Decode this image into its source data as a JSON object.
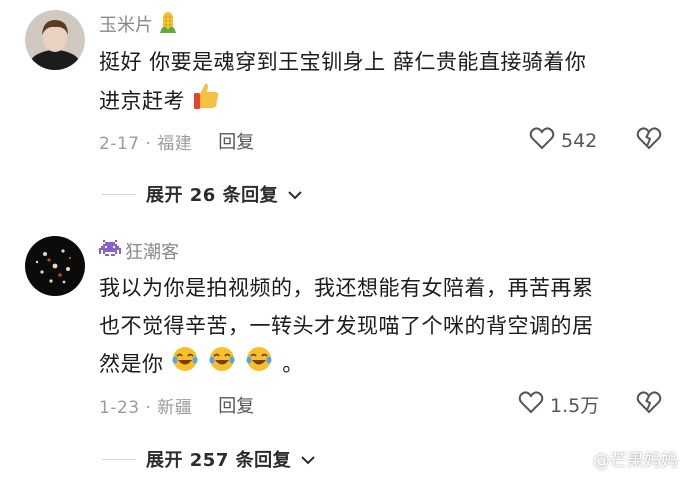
{
  "colors": {
    "username": "#8a8a8a",
    "text": "#1c1c1c",
    "meta": "#9b9b9b",
    "divider": "#d6d6d6"
  },
  "comments": [
    {
      "username": "玉米片",
      "username_badge": "corn-icon",
      "text_line1": "挺好  你要是魂穿到王宝钏身上  薛仁贵能直接骑着你",
      "text_line2": "进京赶考",
      "text_emoji": "thumbs-up-icon",
      "date_location": "2-17 · 福建",
      "reply_label": "回复",
      "likes": "542",
      "expand_label": "展开 26 条回复"
    },
    {
      "username": "狂潮客",
      "username_badge": "space-invader-icon",
      "text_line1": "我以为你是拍视频的，我还想能有女陪着，再苦再累",
      "text_line2": "也不觉得辛苦，一转头才发现喵了个咪的背空调的居",
      "text_line3": "然是你",
      "text_line3_suffix": "。",
      "text_emojis": [
        "laughing-tears-icon",
        "laughing-tears-icon",
        "laughing-tears-icon"
      ],
      "date_location": "1-23 · 新疆",
      "reply_label": "回复",
      "likes": "1.5万",
      "expand_label": "展开 257 条回复"
    }
  ],
  "watermark": "@芒果妈妈"
}
